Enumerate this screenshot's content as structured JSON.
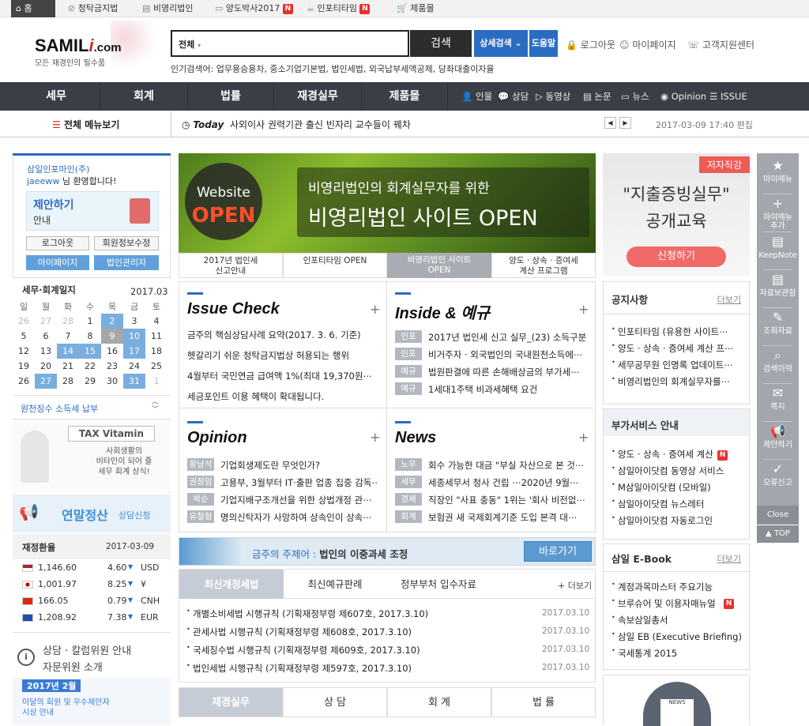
{
  "topbar": {
    "items": [
      "홈",
      "청탁금지법",
      "비영리법인",
      "양도박사2017",
      "인포티타임",
      "제품몰"
    ]
  },
  "header": {
    "logo_main": "SAMIL",
    "logo_i": "i",
    "logo_com": ".com",
    "logo_sub": "모든 재경인의 필수품",
    "search_select": "전체",
    "search_label": "검색",
    "adv_label": "상세검색",
    "help_label": "도움말",
    "links": [
      "로그아웃",
      "마이페이지",
      "고객지원센터"
    ],
    "popular": "인기검색어: 업무용승용차, 중소기업기본법, 법인세법, 외국납부세액공제, 당좌대출이자율"
  },
  "nav": {
    "main": [
      "세무",
      "회계",
      "법률",
      "재경실무",
      "제품몰"
    ],
    "small": [
      "인물",
      "상담",
      "동영상",
      "논문",
      "뉴스",
      "Opinion",
      "ISSUE"
    ]
  },
  "subbar": {
    "all_menu": "전체 메뉴보기",
    "today_label": "Today",
    "headline": "사외이사 권력기관 출신 빈자리 교수들이 꿰차",
    "datetime": "2017-03-09 17:40 편집"
  },
  "left": {
    "company": "삼일인포마인(주)",
    "user": "jaeeww",
    "welcome": " 님 환영합니다!",
    "suggest_title": "제안하기",
    "suggest_sub": "안내",
    "btns": [
      "로그아웃",
      "회원정보수정",
      "마이페이지",
      "법인관리자"
    ],
    "cal_title": "세무·회계일지",
    "cal_month": "2017.03",
    "cal_days": [
      "일",
      "월",
      "화",
      "수",
      "목",
      "금",
      "토"
    ],
    "cal_rows": [
      [
        "26",
        "27",
        "28",
        "1",
        "2",
        "3",
        "4"
      ],
      [
        "5",
        "6",
        "7",
        "8",
        "9",
        "10",
        "11"
      ],
      [
        "12",
        "13",
        "14",
        "15",
        "16",
        "17",
        "18"
      ],
      [
        "19",
        "20",
        "21",
        "22",
        "23",
        "24",
        "25"
      ],
      [
        "26",
        "27",
        "28",
        "29",
        "30",
        "31",
        "1"
      ]
    ],
    "withholding": "원천징수 소득세 납부",
    "tax_vitamin": "TAX Vitamin",
    "tax_text1": "사회생활의",
    "tax_text2": "비타민이 되어 줄",
    "tax_text3": "세무 회계 상식!",
    "yearend": "연말정산",
    "yearend_sub": "상담신청",
    "fx_title": "재정환율",
    "fx_date": "2017-03-09",
    "fx": [
      {
        "rate": "1,146.60",
        "chg": "4.60",
        "cur": "USD",
        "flag": "us"
      },
      {
        "rate": "1,001.97",
        "chg": "8.25",
        "cur": "¥",
        "flag": "jp"
      },
      {
        "rate": "166.05",
        "chg": "0.79",
        "cur": "CNH",
        "flag": "cn"
      },
      {
        "rate": "1,208.92",
        "chg": "7.38",
        "cur": "EUR",
        "flag": "eu"
      }
    ],
    "consult1": "상담 · 칼럼위원 안내",
    "consult2": "자문위원 소개",
    "bottom_year": "2017년 2월",
    "bottom_t1": "이달의 회원 및 우수제안자",
    "bottom_t2": "시상 안내"
  },
  "banner": {
    "website": "Website",
    "open": "OPEN",
    "line1": "비영리법인의 회계실무자를 위한",
    "line2": "비영리법인 사이트 OPEN",
    "tabs": [
      "2017년 법인세\n신고안내",
      "인포티타임 OPEN",
      "비영리법인 사이트\nOPEN",
      "양도 · 상속 · 증여세\n계산 프로그램"
    ]
  },
  "issue": {
    "title": "Issue Check",
    "items": [
      "금주의 핵심상담사례 요약(2017. 3. 6. 기준)",
      "헷갈리기 쉬운 청탁금지법상 허용되는 행위",
      "4월부터 국민연금 급여액 1%(최대 19,370원⋯",
      "세금포인트 이용 혜택이 확대됩니다."
    ]
  },
  "inside": {
    "title": "Inside & 예규",
    "items": [
      {
        "tag": "인포",
        "text": "2017년 법인세 신고 실무_(23) 소득구분"
      },
      {
        "tag": "인포",
        "text": "비거주자 · 외국법인의 국내원천소득에⋯"
      },
      {
        "tag": "예규",
        "text": "법원판결에 따른 손해배상금의 부가세⋯"
      },
      {
        "tag": "예규",
        "text": "1세대1주택 비과세혜택 요건"
      }
    ]
  },
  "opinion": {
    "title": "Opinion",
    "items": [
      {
        "tag": "황남석",
        "text": "기업회생제도란 무엇인가?"
      },
      {
        "tag": "권정임",
        "text": "고용부, 3월부터 IT·출판 업종 집중 감독⋯"
      },
      {
        "tag": "박순",
        "text": "기업지배구조개선을 위한 상법개정 관⋯"
      },
      {
        "tag": "유철형",
        "text": "명의신탁자가 사망하여 상속인이 상속⋯"
      }
    ]
  },
  "news": {
    "title": "News",
    "items": [
      {
        "tag": "노무",
        "text": "회수 가능한 대금 \"부실 자산으로 본 것⋯"
      },
      {
        "tag": "세무",
        "text": "세종세무서 청사 건립 ⋯2020년 9월⋯"
      },
      {
        "tag": "경제",
        "text": "직장인 \"사표 충동\" 1위는 '회사 비전없⋯"
      },
      {
        "tag": "회계",
        "text": "보험권 새 국제회계기준 도입 본격 대⋯"
      }
    ]
  },
  "theme": {
    "label": "금주의 주제어 :",
    "topic": "법인의 이중과세 조정",
    "go": "바로가기"
  },
  "laws": {
    "tabs": [
      "최신개정세법",
      "최신예규판례",
      "정부부처 입수자료"
    ],
    "more": "+ 더보기",
    "items": [
      {
        "text": "개별소비세법 시행규칙 (기획재정부령 제607호, 2017.3.10)",
        "date": "2017.03.10"
      },
      {
        "text": "관세사법 시행규칙 (기획재정부령 제608호, 2017.3.10)",
        "date": "2017.03.10"
      },
      {
        "text": "국세징수법 시행규칙 (기획재정부령 제609호, 2017.3.10)",
        "date": "2017.03.10"
      },
      {
        "text": "법인세법 시행규칙 (기획재정부령 제597호, 2017.3.10)",
        "date": "2017.03.10"
      }
    ]
  },
  "bottom_tabs": [
    "재경실무",
    "상 담",
    "회 계",
    "법 률"
  ],
  "right": {
    "ad_badge": "저자직강",
    "ad_title1": "\"지출증빙실무\"",
    "ad_title2": "공개교육",
    "ad_btn": "신청하기",
    "notice_title": "공지사항",
    "more": "더보기",
    "notice": [
      "인포티타임 (유용한 사이트⋯",
      "양도 · 상속 · 증여세 계산 프⋯",
      "세무공무원 인명록 업데이트⋯",
      "비영리법인의 회계실무자를⋯"
    ],
    "extra_title": "부가서비스 안내",
    "extra": [
      "양도 · 상속 · 증여세 계산",
      "삼일아이닷컴 동영상 서비스",
      "M삼일아이닷컴 (모바일)",
      "삼일아이닷컴 뉴스레터",
      "삼일아이닷컴 자동로그인"
    ],
    "ebook_title": "삼일 E-Book",
    "ebook": [
      "계정과목마스터 주요기능",
      "브루슈어 및 이용자매뉴얼",
      "속보삼일총서",
      "삼일 EB (Executive Briefing)",
      "국세통계 2015"
    ],
    "news_icon": "NEWS"
  },
  "rail": {
    "items": [
      "마이메뉴",
      "마이메뉴\n추가",
      "KeepNote",
      "자료보관함",
      "조회자료",
      "검색이력",
      "쪽지",
      "제안하기",
      "오류신고"
    ],
    "close": "Close",
    "top": "TOP"
  },
  "colors": {
    "nav": "#3a3f47",
    "blue": "#2a6cc2",
    "red": "#e8312f",
    "tag": "#b3b8c0"
  }
}
